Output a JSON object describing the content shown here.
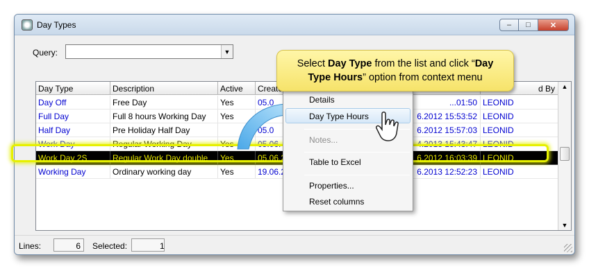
{
  "window": {
    "title": "Day Types",
    "buttons": {
      "minimize": "–",
      "maximize": "□",
      "close": "✕"
    }
  },
  "query": {
    "label": "Query:",
    "value": ""
  },
  "grid": {
    "columns": [
      "Day Type",
      "Description",
      "Active",
      "Create",
      "d By"
    ],
    "rows": [
      {
        "day_type": "Day Off",
        "description": "Free Day",
        "active": "Yes",
        "created": "05.0",
        "modified": "...01:50",
        "modified_by": "LEONID",
        "selected": false
      },
      {
        "day_type": "Full Day",
        "description": "Full 8 hours Working Day",
        "active": "Yes",
        "created": "",
        "modified": "6.2012 15:53:52",
        "modified_by": "LEONID",
        "selected": false
      },
      {
        "day_type": "Half Day",
        "description": "Pre Holiday Half Day",
        "active": "",
        "created": "05.0",
        "modified": "6.2012 15:57:03",
        "modified_by": "LEONID",
        "selected": false
      },
      {
        "day_type": "Work Day",
        "description": "Regular Working Day",
        "active": "Yes",
        "created": "05.06.",
        "modified": "4.2013 15:43:47",
        "modified_by": "LEONID",
        "selected": false
      },
      {
        "day_type": "Work Day 2S",
        "description": "Regular Work Day double",
        "active": "Yes",
        "created": "05.06.2",
        "modified": "6.2012 16:03:39",
        "modified_by": "LEONID",
        "selected": true
      },
      {
        "day_type": "Working Day",
        "description": "Ordinary working day",
        "active": "Yes",
        "created": "19.06.2",
        "modified": "6.2013 12:52:23",
        "modified_by": "LEONID",
        "selected": false
      }
    ]
  },
  "status": {
    "lines_label": "Lines:",
    "lines_value": "6",
    "selected_label": "Selected:",
    "selected_value": "1"
  },
  "context_menu": {
    "items": [
      {
        "label": "Details",
        "enabled": true
      },
      {
        "label": "Day Type Hours",
        "enabled": true,
        "hover": true
      },
      {
        "label": "Notes...",
        "enabled": false
      },
      {
        "label": "Table to Excel",
        "enabled": true
      },
      {
        "label": "Properties...",
        "enabled": true
      },
      {
        "label": "Reset columns",
        "enabled": true
      }
    ]
  },
  "callout": {
    "line1_a": "Select ",
    "line1_b": "Day Type",
    "line1_c": " from the list and click “",
    "line1_d": "Day",
    "line2_a": "Type Hours",
    "line2_b": "” option from context menu"
  },
  "colors": {
    "link_blue": "#0000d0",
    "selected_text": "#e8e800",
    "highlight": "#e6f000",
    "callout_bg": "#f6e36a"
  },
  "icons": [
    "app-icon",
    "dropdown-arrow-icon",
    "scroll-up-icon",
    "scroll-down-icon",
    "hand-cursor-icon",
    "curved-arrow-icon"
  ]
}
